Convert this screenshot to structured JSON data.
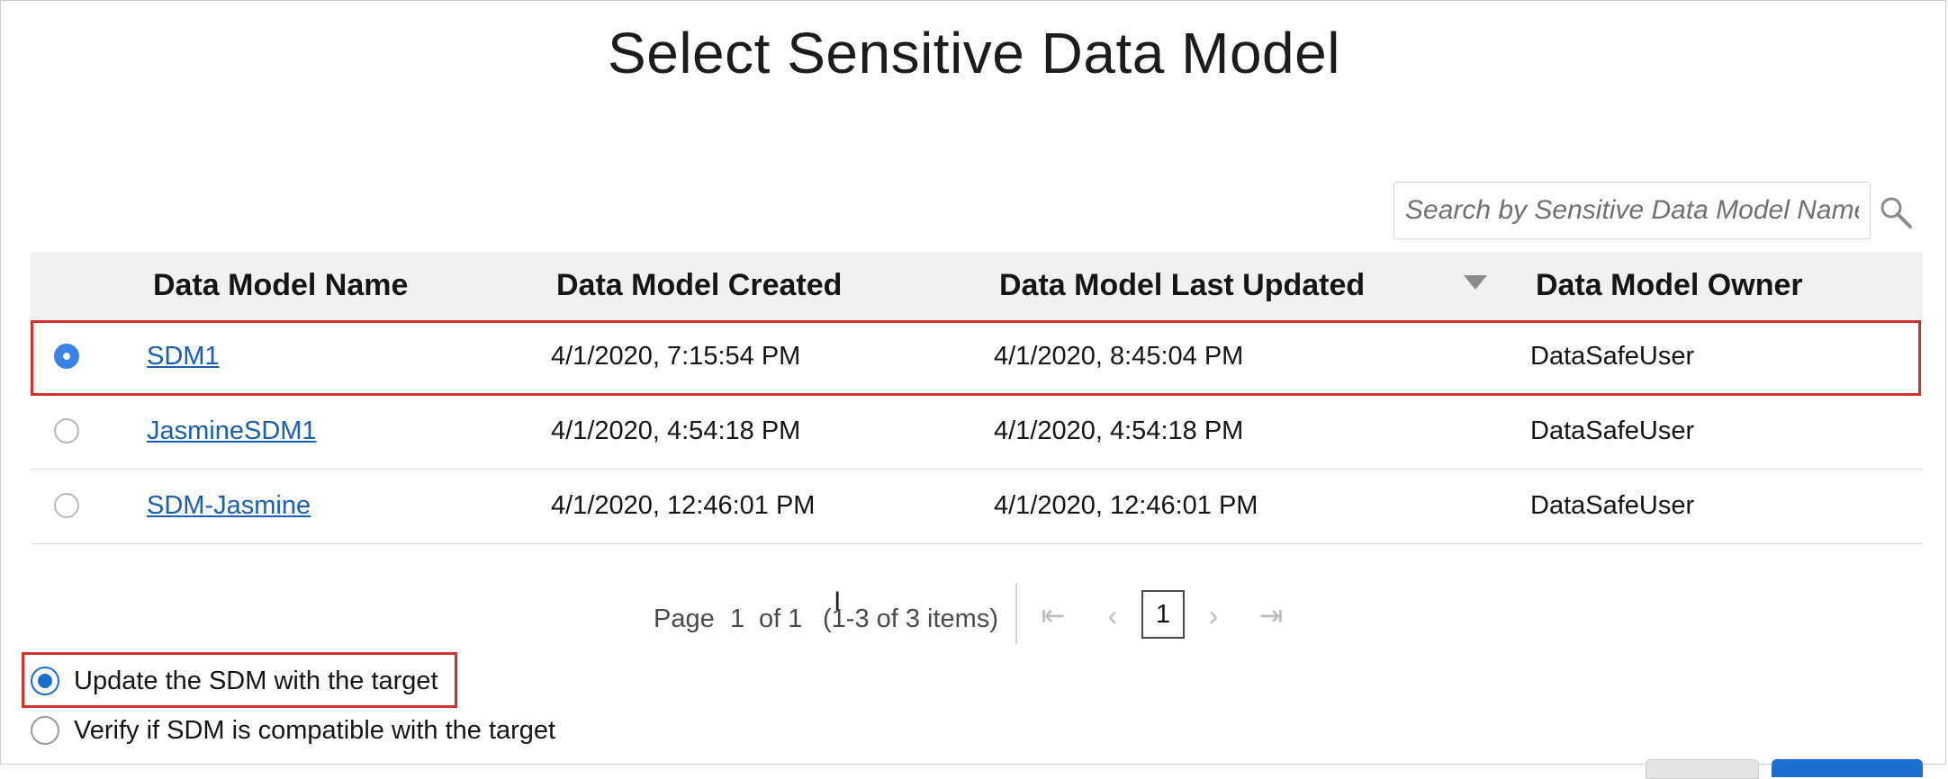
{
  "title": "Select Sensitive Data Model",
  "search": {
    "placeholder": "Search by Sensitive Data Model Name",
    "icon": "search-icon"
  },
  "table": {
    "columns": [
      "Data Model Name",
      "Data Model Created",
      "Data Model Last Updated",
      "Data Model Owner"
    ],
    "sorted_column": "Data Model Last Updated",
    "sort_direction": "descending",
    "rows": [
      {
        "selected": true,
        "name": "SDM1",
        "created": "4/1/2020, 7:15:54 PM",
        "updated": "4/1/2020, 8:45:04 PM",
        "owner": "DataSafeUser"
      },
      {
        "selected": false,
        "name": "JasmineSDM1",
        "created": "4/1/2020, 4:54:18 PM",
        "updated": "4/1/2020, 4:54:18 PM",
        "owner": "DataSafeUser"
      },
      {
        "selected": false,
        "name": "SDM-Jasmine",
        "created": "4/1/2020, 12:46:01 PM",
        "updated": "4/1/2020, 12:46:01 PM",
        "owner": "DataSafeUser"
      }
    ]
  },
  "pagination": {
    "page_label": "Page",
    "page_number": "1",
    "of_label": "of 1",
    "items_label": "(1-3 of 3 items)",
    "current_page": "1"
  },
  "options": [
    {
      "label": "Update the SDM with the target",
      "checked": true
    },
    {
      "label": "Verify if SDM is compatible with the target",
      "checked": false
    }
  ],
  "colors": {
    "highlight": "#d2322d",
    "link": "#1a5fb4",
    "radio_selected": "#3a82e8",
    "option_selected": "#1a6fd0"
  }
}
